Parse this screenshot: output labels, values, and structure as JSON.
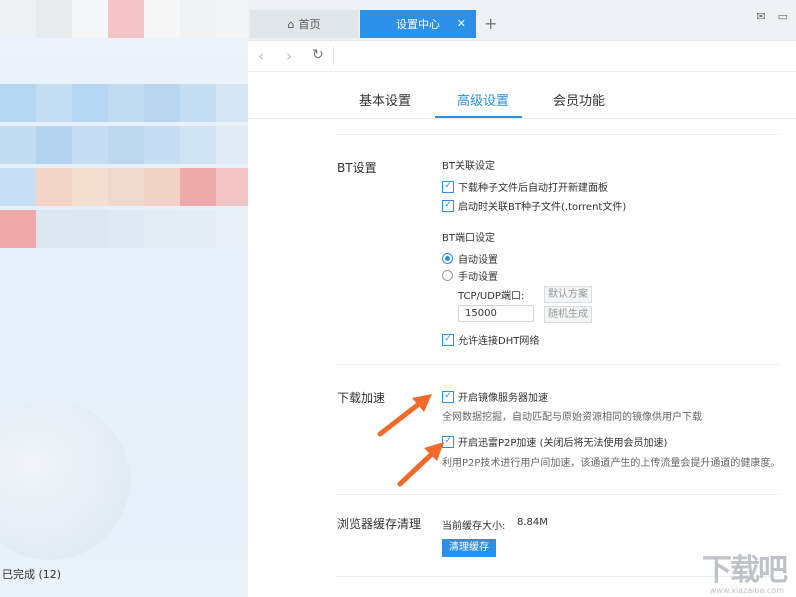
{
  "sidebar": {
    "status": "已完成 (12)"
  },
  "tabs": {
    "home": "首页",
    "active": "设置中心",
    "add": "+"
  },
  "settings_tabs": [
    "基本设置",
    "高级设置",
    "会员功能"
  ],
  "bt": {
    "title": "BT设置",
    "assoc_title": "BT关联设定",
    "opt1": "下载种子文件后自动打开新建面板",
    "opt2": "启动时关联BT种子文件(.torrent文件)",
    "port_title": "BT端口设定",
    "auto": "自动设置",
    "manual": "手动设置",
    "port_label": "TCP/UDP端口:",
    "port_value": "15000",
    "default_btn": "默认方案",
    "random_btn": "随机生成",
    "dht": "允许连接DHT网络"
  },
  "accel": {
    "title": "下载加速",
    "mirror": "开启镜像服务器加速",
    "mirror_desc": "全网数据挖掘，自动匹配与原始资源相同的镜像供用户下载",
    "p2p": "开启迅雷P2P加速 (关闭后将无法使用会员加速)",
    "p2p_desc": "利用P2P技术进行用户间加速，该通道产生的上传流量会提升通道的健康度。"
  },
  "cache": {
    "title": "浏览器缓存清理",
    "size_label": "当前缓存大小:",
    "size_value": "8.84M",
    "clear_btn": "清理缓存"
  },
  "watermark": {
    "text": "下载吧",
    "url": "www.xiazaiba.com"
  },
  "colors": {
    "accent": "#2c8fe8",
    "arrow": "#f26a2a"
  }
}
